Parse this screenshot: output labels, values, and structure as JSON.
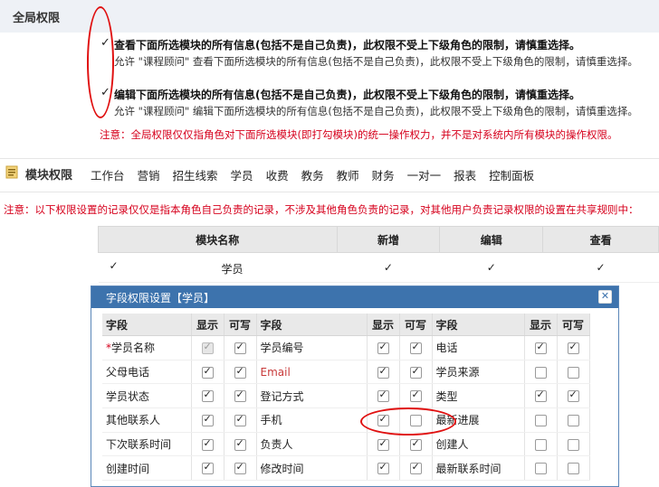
{
  "global": {
    "title": "全局权限",
    "options": [
      {
        "check": "✓",
        "title": "查看下面所选模块的所有信息(包括不是自己负责)，此权限不受上下级角色的限制，请慎重选择。",
        "desc": "允许 \"课程顾问\" 查看下面所选模块的所有信息(包括不是自己负责)，此权限不受上下级角色的限制，请慎重选择。"
      },
      {
        "check": "✓",
        "title": "编辑下面所选模块的所有信息(包括不是自己负责)，此权限不受上下级角色的限制，请慎重选择。",
        "desc": "允许 \"课程顾问\" 编辑下面所选模块的所有信息(包括不是自己负责)，此权限不受上下级角色的限制，请慎重选择。"
      }
    ],
    "note": "注意：全局权限仅仅指角色对下面所选模块(即打勾模块)的统一操作权力，并不是对系统内所有模块的操作权限。"
  },
  "module": {
    "title": "模块权限",
    "tabs": [
      "工作台",
      "营销",
      "招生线索",
      "学员",
      "收费",
      "教务",
      "教师",
      "财务",
      "一对一",
      "报表",
      "控制面板"
    ],
    "note": "注意：以下权限设置的记录仅仅是指本角色自己负责的记录，不涉及其他角色负责的记录，对其他用户负责记录权限的设置在共享规则中："
  },
  "module_table": {
    "headers": [
      "模块名称",
      "新增",
      "编辑",
      "查看"
    ],
    "row": {
      "check": "✓",
      "name": "学员",
      "add": "✓",
      "edit": "✓",
      "view": "✓"
    }
  },
  "dialog": {
    "title": "字段权限设置【学员】",
    "close": "✕",
    "headers": {
      "field": "字段",
      "show": "显示",
      "write": "可写"
    },
    "rows": [
      [
        {
          "name": "学员名称",
          "req": "*",
          "show": true,
          "write": true,
          "showDisabled": true
        },
        {
          "name": "学员编号",
          "show": true,
          "write": true
        },
        {
          "name": "电话",
          "show": true,
          "write": true
        }
      ],
      [
        {
          "name": "父母电话",
          "show": true,
          "write": true
        },
        {
          "name": "Email",
          "show": true,
          "write": true,
          "red": true
        },
        {
          "name": "学员来源",
          "show": false,
          "write": false
        }
      ],
      [
        {
          "name": "学员状态",
          "show": true,
          "write": true
        },
        {
          "name": "登记方式",
          "show": true,
          "write": true
        },
        {
          "name": "类型",
          "show": true,
          "write": true
        }
      ],
      [
        {
          "name": "其他联系人",
          "show": true,
          "write": true
        },
        {
          "name": "手机",
          "show": true,
          "write": false
        },
        {
          "name": "最新进展",
          "show": false,
          "write": false
        }
      ],
      [
        {
          "name": "下次联系时间",
          "show": true,
          "write": true
        },
        {
          "name": "负责人",
          "show": true,
          "write": true
        },
        {
          "name": "创建人",
          "show": false,
          "write": false
        }
      ],
      [
        {
          "name": "创建时间",
          "show": true,
          "write": true
        },
        {
          "name": "修改时间",
          "show": true,
          "write": true
        },
        {
          "name": "最新联系时间",
          "show": false,
          "write": false
        }
      ]
    ]
  },
  "colors": {
    "accent": "#3d73ad",
    "warning": "#d6001c",
    "annotation": "#e01010"
  }
}
